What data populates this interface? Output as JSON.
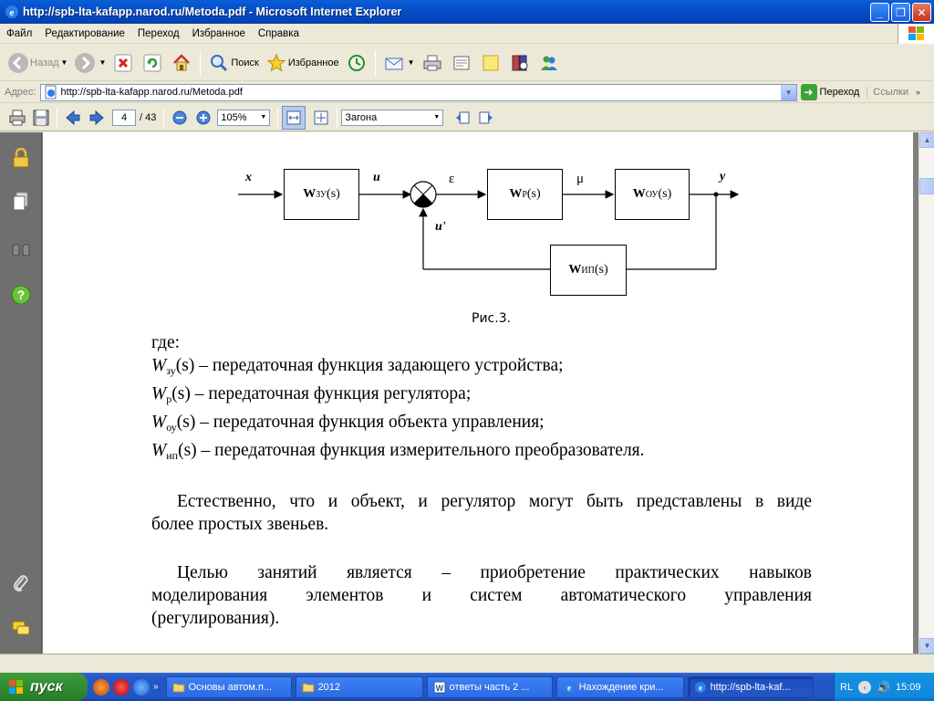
{
  "window": {
    "title": "http://spb-lta-kafapp.narod.ru/Metoda.pdf - Microsoft Internet Explorer"
  },
  "menu": [
    "Файл",
    "Редактирование",
    "Переход",
    "Избранное",
    "Справка"
  ],
  "toolbar": {
    "back_label": "Назад",
    "search_label": "Поиск",
    "favorites_label": "Избранное"
  },
  "address": {
    "label": "Адрес:",
    "url": "http://spb-lta-kafapp.narod.ru/Metoda.pdf",
    "go_label": "Переход",
    "links_label": "Ссылки"
  },
  "pdf_toolbar": {
    "page_current": "4",
    "page_total": "/ 43",
    "zoom": "105%",
    "find_value": "Загона"
  },
  "diagram": {
    "blocks": {
      "w_zu": "W",
      "w_zu_sub": "ЗУ",
      "w_zu_tail": "(s)",
      "w_p": "W",
      "w_p_sub": "Р",
      "w_p_tail": "(s)",
      "w_ou": "W",
      "w_ou_sub": "ОУ",
      "w_ou_tail": "(s)",
      "w_ip": "W",
      "w_ip_sub": "ИП",
      "w_ip_tail": "(s)"
    },
    "signals": {
      "x": "x",
      "u": "u",
      "eps": "ε",
      "mu": "μ",
      "y": "y",
      "u_prime": "u'"
    },
    "caption": "Рис.3."
  },
  "text": {
    "where": "где:",
    "defs": [
      {
        "sym": "W",
        "sub": "зу",
        "rest": "(s) – передаточная функция задающего устройства;"
      },
      {
        "sym": "W",
        "sub": "р",
        "rest": "(s) – передаточная функция регулятора;"
      },
      {
        "sym": "W",
        "sub": "оу",
        "rest": "(s) – передаточная функция объекта управления;"
      },
      {
        "sym": "W",
        "sub": "ип",
        "rest": "(s) – передаточная функция измерительного преобразователя."
      }
    ],
    "para1_line1": "Естественно, что и объект, и регулятор могут быть представлены в виде",
    "para1_line2": "более простых звеньев.",
    "para2_line1": "Целью занятий является – приобретение практических навыков",
    "para2_line2": "моделирования элементов и систем автоматического управления",
    "para2_line3": "(регулирования)."
  },
  "taskbar": {
    "start_label": "пуск",
    "tasks": [
      "Основы автом.п...",
      "2012",
      "ответы часть 2 ...",
      "Нахождение кри...",
      "http://spb-lta-kaf..."
    ],
    "lang": "RL",
    "time": "15:09"
  }
}
